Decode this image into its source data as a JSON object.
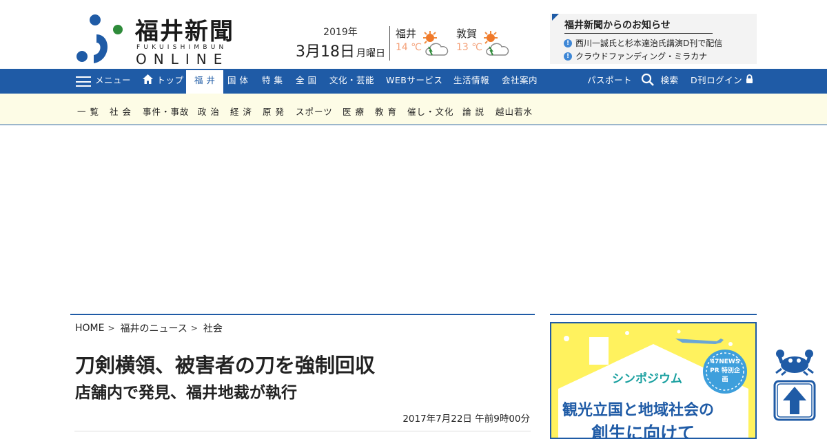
{
  "brand": {
    "name_jp": "福井新聞",
    "name_roman": "FUKUISHIMBUN",
    "online": "ONLINE"
  },
  "date": {
    "year": "2019年",
    "month_day": "3月18日",
    "weekday": "月曜日"
  },
  "weather": [
    {
      "city": "福井",
      "temp": "14 ℃",
      "icon": "sun-cloud-icon"
    },
    {
      "city": "敦賀",
      "temp": "13 ℃",
      "icon": "sun-cloud-icon"
    }
  ],
  "notice": {
    "title": "福井新聞からのお知らせ",
    "items": [
      "西川一誠氏と杉本達治氏講演D刊で配信",
      "クラウドファンディング・ミラカナ"
    ]
  },
  "nav": {
    "menu": "メニュー",
    "top": "トップ",
    "items": [
      "福 井",
      "国 体",
      "特 集",
      "全 国",
      "文化・芸能",
      "WEBサービス",
      "生活情報",
      "会社案内"
    ],
    "passport": "パスポート",
    "search": "検索",
    "login": "D刊ログイン"
  },
  "subnav": [
    "一 覧",
    "社 会",
    "事件・事故",
    "政 治",
    "経 済",
    "原 発",
    "スポーツ",
    "医 療",
    "教 育",
    "催し・文化",
    "論 説",
    "越山若水"
  ],
  "breadcrumb": [
    "HOME",
    "福井のニュース",
    "社会"
  ],
  "article": {
    "headline": "刀剣横領、被害者の刀を強制回収",
    "subheadline": "店舗内で発見、福井地裁が執行",
    "date": "2017年7月22日 午前9時00分"
  },
  "ad": {
    "label": "シンポジウム",
    "badge": "47NEWS PR 特別企画",
    "headline_1": "観光立国と地域社会の",
    "headline_2": "創生に向けて"
  },
  "colors": {
    "brand_blue": "#1f5ba6",
    "subnav_bg": "#fdfce6",
    "temp": "#f4a27a",
    "ad_bg": "#fff25e"
  }
}
